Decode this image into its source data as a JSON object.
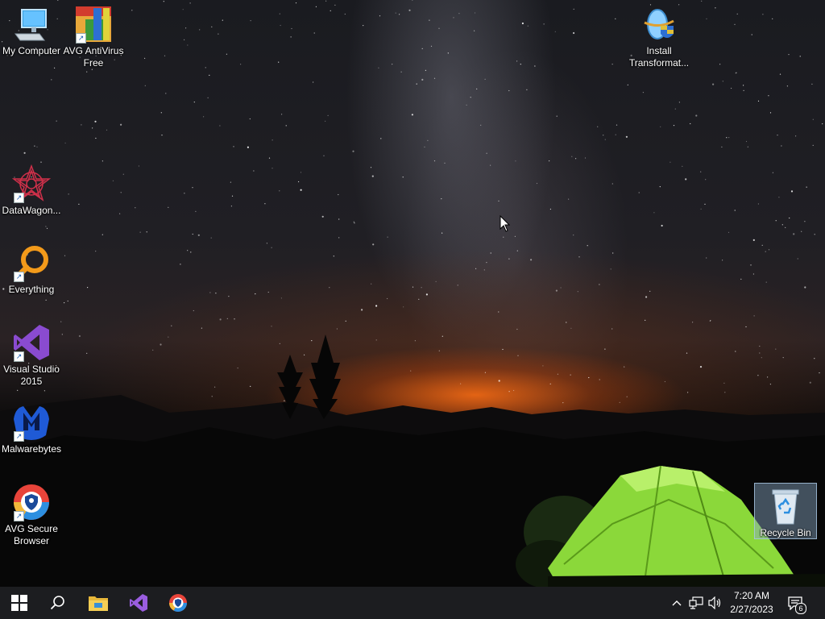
{
  "desktop": {
    "icons": [
      {
        "label": "My Computer",
        "icon": "computer-icon"
      },
      {
        "label": "AVG AntiVirus Free",
        "icon": "avg-antivirus-icon"
      },
      {
        "label": "Install Transformat...",
        "icon": "installer-icon"
      },
      {
        "label": "DataWagon...",
        "icon": "datawagon-icon"
      },
      {
        "label": "Everything",
        "icon": "everything-search-icon"
      },
      {
        "label": "Visual Studio 2015",
        "icon": "visual-studio-icon"
      },
      {
        "label": "Malwarebytes",
        "icon": "malwarebytes-icon"
      },
      {
        "label": "AVG Secure Browser",
        "icon": "avg-secure-browser-icon"
      },
      {
        "label": "Recycle Bin",
        "icon": "recycle-bin-icon"
      }
    ]
  },
  "taskbar": {
    "pinned": [
      {
        "icon": "windows-start-icon"
      },
      {
        "icon": "search-icon"
      },
      {
        "icon": "file-explorer-icon"
      },
      {
        "icon": "visual-studio-icon"
      },
      {
        "icon": "avg-secure-browser-icon"
      }
    ],
    "tray": {
      "icons": [
        "chevron-up-icon",
        "network-icon",
        "volume-icon"
      ],
      "time": "7:20 AM",
      "date": "2/27/2023",
      "notification_count": "6"
    }
  },
  "colors": {
    "taskbar_bg": "#1c1d20",
    "tent_green": "#7ed321",
    "horizon_orange": "#ff6e14"
  }
}
